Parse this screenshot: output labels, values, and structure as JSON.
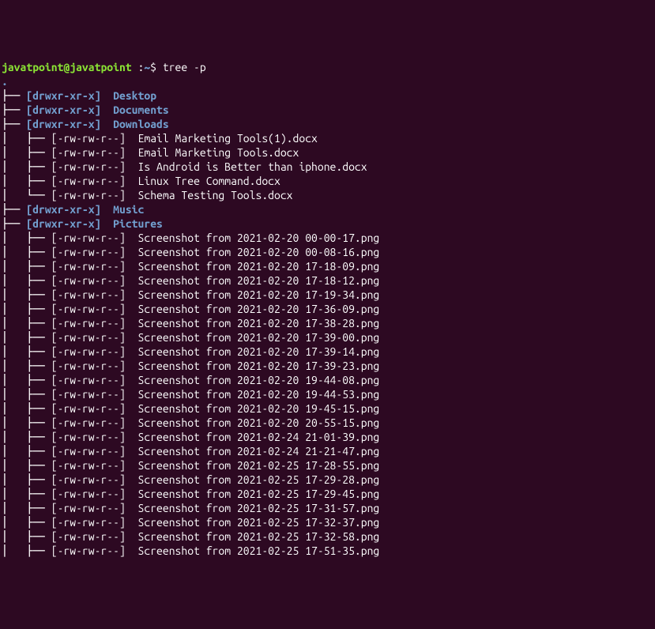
{
  "prompt": {
    "user_host": "javatpoint@javatpoint",
    "path": " :",
    "tilde": "~",
    "dollar": "$ ",
    "command": "tree -p"
  },
  "dot": ".",
  "dirs": [
    {
      "prefix": "├── ",
      "perm": "[drwxr-xr-x]",
      "name": "Desktop"
    },
    {
      "prefix": "├── ",
      "perm": "[drwxr-xr-x]",
      "name": "Documents"
    },
    {
      "prefix": "├── ",
      "perm": "[drwxr-xr-x]",
      "name": "Downloads"
    }
  ],
  "downloads_files": [
    {
      "prefix": "│   ├── ",
      "perm": "[-rw-rw-r--]",
      "name": "Email Marketing Tools(1).docx"
    },
    {
      "prefix": "│   ├── ",
      "perm": "[-rw-rw-r--]",
      "name": "Email Marketing Tools.docx"
    },
    {
      "prefix": "│   ├── ",
      "perm": "[-rw-rw-r--]",
      "name": "Is Android is Better than iphone.docx"
    },
    {
      "prefix": "│   ├── ",
      "perm": "[-rw-rw-r--]",
      "name": "Linux Tree Command.docx"
    },
    {
      "prefix": "│   └── ",
      "perm": "[-rw-rw-r--]",
      "name": "Schema Testing Tools.docx"
    }
  ],
  "dirs2": [
    {
      "prefix": "├── ",
      "perm": "[drwxr-xr-x]",
      "name": "Music"
    },
    {
      "prefix": "├── ",
      "perm": "[drwxr-xr-x]",
      "name": "Pictures"
    }
  ],
  "pictures_files": [
    {
      "prefix": "│   ├── ",
      "perm": "[-rw-rw-r--]",
      "name": "Screenshot from 2021-02-20 00-00-17.png"
    },
    {
      "prefix": "│   ├── ",
      "perm": "[-rw-rw-r--]",
      "name": "Screenshot from 2021-02-20 00-08-16.png"
    },
    {
      "prefix": "│   ├── ",
      "perm": "[-rw-rw-r--]",
      "name": "Screenshot from 2021-02-20 17-18-09.png"
    },
    {
      "prefix": "│   ├── ",
      "perm": "[-rw-rw-r--]",
      "name": "Screenshot from 2021-02-20 17-18-12.png"
    },
    {
      "prefix": "│   ├── ",
      "perm": "[-rw-rw-r--]",
      "name": "Screenshot from 2021-02-20 17-19-34.png"
    },
    {
      "prefix": "│   ├── ",
      "perm": "[-rw-rw-r--]",
      "name": "Screenshot from 2021-02-20 17-36-09.png"
    },
    {
      "prefix": "│   ├── ",
      "perm": "[-rw-rw-r--]",
      "name": "Screenshot from 2021-02-20 17-38-28.png"
    },
    {
      "prefix": "│   ├── ",
      "perm": "[-rw-rw-r--]",
      "name": "Screenshot from 2021-02-20 17-39-00.png"
    },
    {
      "prefix": "│   ├── ",
      "perm": "[-rw-rw-r--]",
      "name": "Screenshot from 2021-02-20 17-39-14.png"
    },
    {
      "prefix": "│   ├── ",
      "perm": "[-rw-rw-r--]",
      "name": "Screenshot from 2021-02-20 17-39-23.png"
    },
    {
      "prefix": "│   ├── ",
      "perm": "[-rw-rw-r--]",
      "name": "Screenshot from 2021-02-20 19-44-08.png"
    },
    {
      "prefix": "│   ├── ",
      "perm": "[-rw-rw-r--]",
      "name": "Screenshot from 2021-02-20 19-44-53.png"
    },
    {
      "prefix": "│   ├── ",
      "perm": "[-rw-rw-r--]",
      "name": "Screenshot from 2021-02-20 19-45-15.png"
    },
    {
      "prefix": "│   ├── ",
      "perm": "[-rw-rw-r--]",
      "name": "Screenshot from 2021-02-20 20-55-15.png"
    },
    {
      "prefix": "│   ├── ",
      "perm": "[-rw-rw-r--]",
      "name": "Screenshot from 2021-02-24 21-01-39.png"
    },
    {
      "prefix": "│   ├── ",
      "perm": "[-rw-rw-r--]",
      "name": "Screenshot from 2021-02-24 21-21-47.png"
    },
    {
      "prefix": "│   ├── ",
      "perm": "[-rw-rw-r--]",
      "name": "Screenshot from 2021-02-25 17-28-55.png"
    },
    {
      "prefix": "│   ├── ",
      "perm": "[-rw-rw-r--]",
      "name": "Screenshot from 2021-02-25 17-29-28.png"
    },
    {
      "prefix": "│   ├── ",
      "perm": "[-rw-rw-r--]",
      "name": "Screenshot from 2021-02-25 17-29-45.png"
    },
    {
      "prefix": "│   ├── ",
      "perm": "[-rw-rw-r--]",
      "name": "Screenshot from 2021-02-25 17-31-57.png"
    },
    {
      "prefix": "│   ├── ",
      "perm": "[-rw-rw-r--]",
      "name": "Screenshot from 2021-02-25 17-32-37.png"
    },
    {
      "prefix": "│   ├── ",
      "perm": "[-rw-rw-r--]",
      "name": "Screenshot from 2021-02-25 17-32-58.png"
    },
    {
      "prefix": "│   ├── ",
      "perm": "[-rw-rw-r--]",
      "name": "Screenshot from 2021-02-25 17-51-35.png"
    }
  ]
}
